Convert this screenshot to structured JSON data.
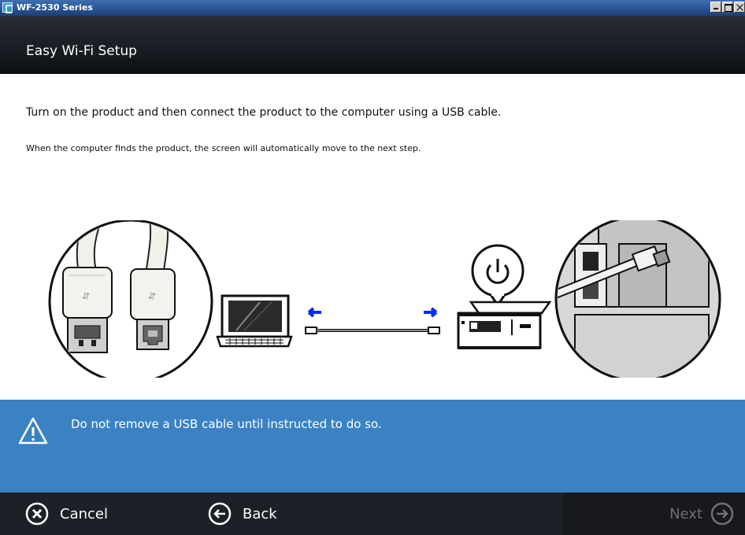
{
  "window": {
    "title": "WF-2530 Series"
  },
  "header": {
    "title": "Easy Wi-Fi Setup"
  },
  "content": {
    "instruction": "Turn on the product and then connect the product to the computer using a USB cable.",
    "sub_instruction": "When the computer finds the product, the screen will automatically move to the next step."
  },
  "illustration": {
    "icons": [
      "usb-connectors-icon",
      "laptop-icon",
      "usb-cable-icon",
      "power-icon",
      "printer-icon",
      "printer-usb-port-icon"
    ]
  },
  "warning": {
    "text": "Do not remove a USB cable until instructed to do so.",
    "icon": "warning-triangle-icon"
  },
  "footer": {
    "cancel_label": "Cancel",
    "back_label": "Back",
    "next_label": "Next"
  },
  "colors": {
    "header_bg": "#0c0f14",
    "warning_bg": "#3a82c4",
    "footer_bg": "#1d2027",
    "arrow_blue": "#0a2cf0"
  }
}
